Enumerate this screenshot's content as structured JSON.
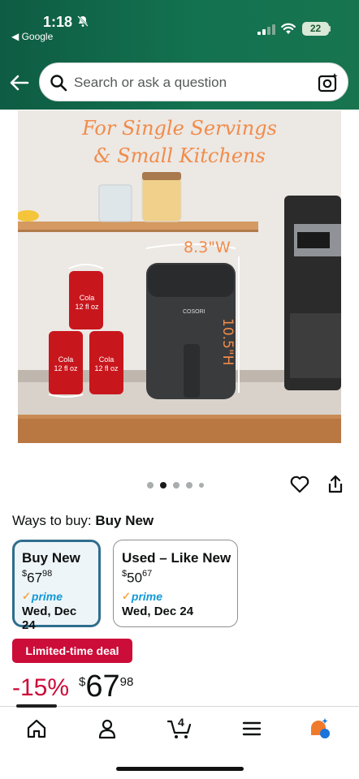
{
  "status_bar": {
    "time": "1:18",
    "back_label": "◀ Google",
    "battery": "22"
  },
  "search": {
    "placeholder": "Search or ask a question"
  },
  "product_image": {
    "headline_line1": "For Single Servings",
    "headline_line2": "& Small Kitchens",
    "width_label": "8.3\"W",
    "height_label": "10.5\"H",
    "brand": "COSORI",
    "can_label_1": "Cola",
    "can_label_2": "12 fl oz"
  },
  "carousel": {
    "count": 5,
    "active_index": 1
  },
  "ways_to_buy": {
    "prefix": "Ways to buy: ",
    "selected": "Buy New"
  },
  "options": [
    {
      "title": "Buy New",
      "currency": "$",
      "whole": "67",
      "fraction": "98",
      "prime": "prime",
      "delivery": "Wed, Dec 24",
      "selected": true
    },
    {
      "title": "Used – Like New",
      "currency": "$",
      "whole": "50",
      "fraction": "67",
      "prime": "prime",
      "delivery": "Wed, Dec 24",
      "selected": false
    }
  ],
  "deal": {
    "label": "Limited-time deal"
  },
  "price": {
    "discount": "-15%",
    "currency": "$",
    "whole": "67",
    "fraction": "98"
  },
  "nav": {
    "cart_count": "4"
  },
  "colors": {
    "header": "#137250",
    "deal": "#cc0c39",
    "prime": "#1399d6",
    "selected_border": "#2f6e8e"
  }
}
